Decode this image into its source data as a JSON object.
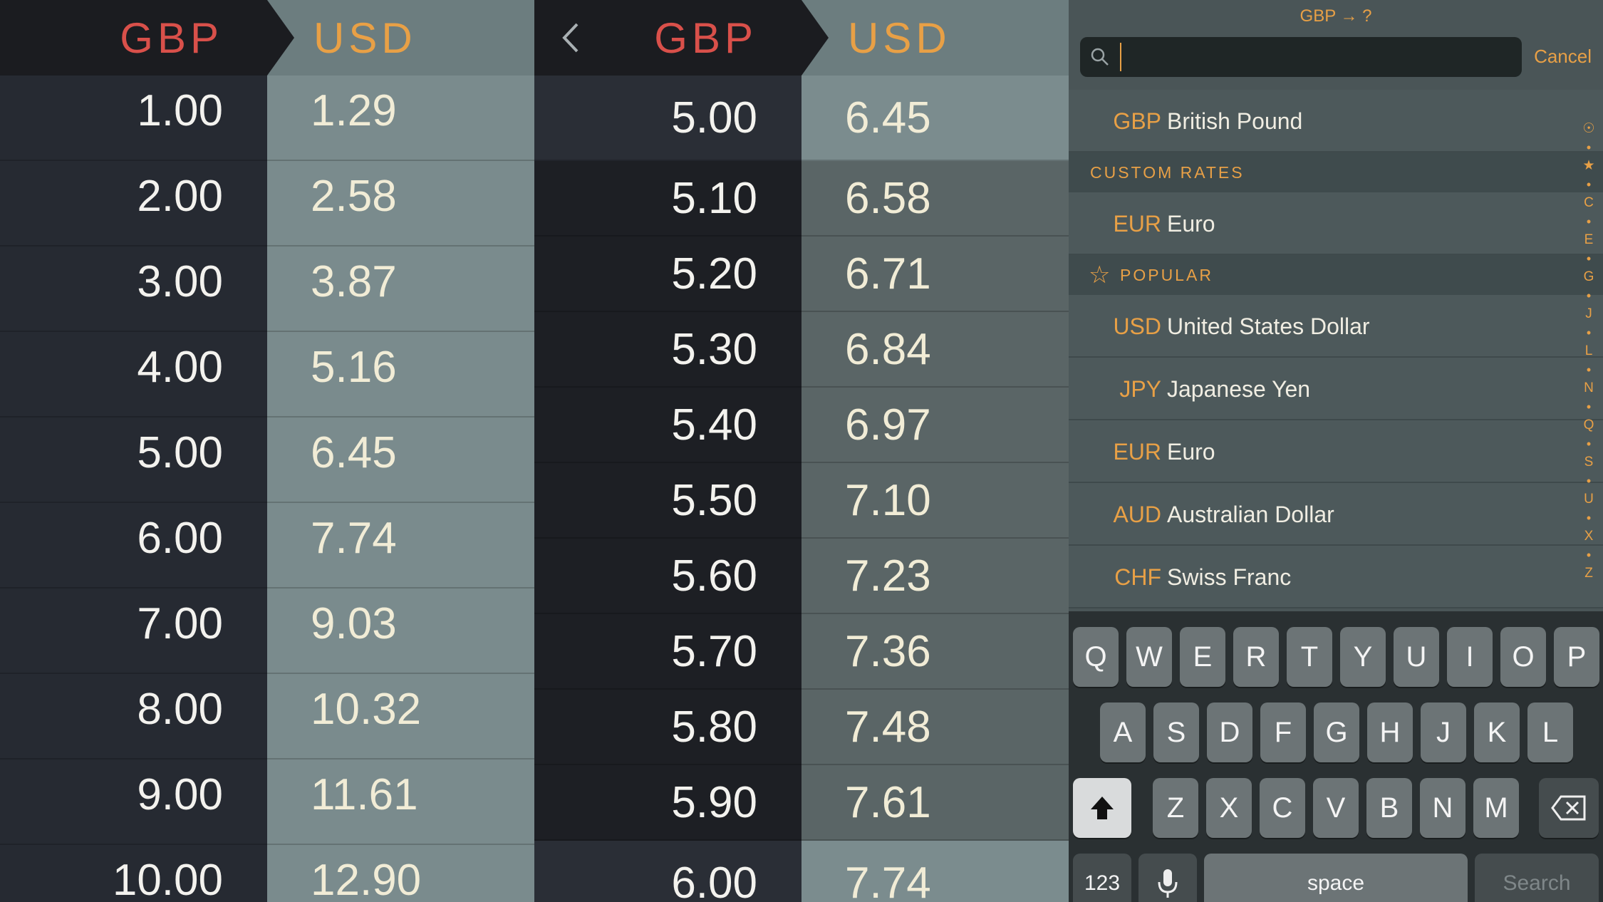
{
  "screen1": {
    "from_code": "GBP",
    "to_code": "USD",
    "rows": [
      {
        "from": "1.00",
        "to": "1.29"
      },
      {
        "from": "2.00",
        "to": "2.58"
      },
      {
        "from": "3.00",
        "to": "3.87"
      },
      {
        "from": "4.00",
        "to": "5.16"
      },
      {
        "from": "5.00",
        "to": "6.45"
      },
      {
        "from": "6.00",
        "to": "7.74"
      },
      {
        "from": "7.00",
        "to": "9.03"
      },
      {
        "from": "8.00",
        "to": "10.32"
      },
      {
        "from": "9.00",
        "to": "11.61"
      },
      {
        "from": "10.00",
        "to": "12.90"
      }
    ]
  },
  "screen2": {
    "back_label": "<",
    "from_code": "GBP",
    "to_code": "USD",
    "rows": [
      {
        "from": "5.00",
        "to": "6.45"
      },
      {
        "from": "5.10",
        "to": "6.58"
      },
      {
        "from": "5.20",
        "to": "6.71"
      },
      {
        "from": "5.30",
        "to": "6.84"
      },
      {
        "from": "5.40",
        "to": "6.97"
      },
      {
        "from": "5.50",
        "to": "7.10"
      },
      {
        "from": "5.60",
        "to": "7.23"
      },
      {
        "from": "5.70",
        "to": "7.36"
      },
      {
        "from": "5.80",
        "to": "7.48"
      },
      {
        "from": "5.90",
        "to": "7.61"
      },
      {
        "from": "6.00",
        "to": "7.74"
      }
    ]
  },
  "picker": {
    "title": "GBP → ?",
    "search_placeholder": "",
    "cancel_label": "Cancel",
    "base": {
      "code": "GBP",
      "name": "British Pound"
    },
    "custom_title": "CUSTOM RATES",
    "custom": [
      {
        "code": "EUR",
        "name": "Euro"
      }
    ],
    "popular_title": "POPULAR",
    "popular": [
      {
        "code": "USD",
        "name": "United States Dollar"
      },
      {
        "code": "JPY",
        "name": "Japanese Yen"
      },
      {
        "code": "EUR",
        "name": "Euro"
      },
      {
        "code": "AUD",
        "name": "Australian Dollar"
      },
      {
        "code": "CHF",
        "name": "Swiss Franc"
      }
    ],
    "index": [
      "☉",
      "•",
      "★",
      "•",
      "C",
      "•",
      "E",
      "•",
      "G",
      "•",
      "J",
      "•",
      "L",
      "•",
      "N",
      "•",
      "Q",
      "•",
      "S",
      "•",
      "U",
      "•",
      "X",
      "•",
      "Z"
    ]
  },
  "keyboard": {
    "row1": [
      "Q",
      "W",
      "E",
      "R",
      "T",
      "Y",
      "U",
      "I",
      "O",
      "P"
    ],
    "row2": [
      "A",
      "S",
      "D",
      "F",
      "G",
      "H",
      "J",
      "K",
      "L"
    ],
    "row3": [
      "Z",
      "X",
      "C",
      "V",
      "B",
      "N",
      "M"
    ],
    "numbers_label": "123",
    "space_label": "space",
    "search_label": "Search"
  },
  "colors": {
    "from_accent": "#d9504a",
    "to_accent": "#e8a046"
  }
}
